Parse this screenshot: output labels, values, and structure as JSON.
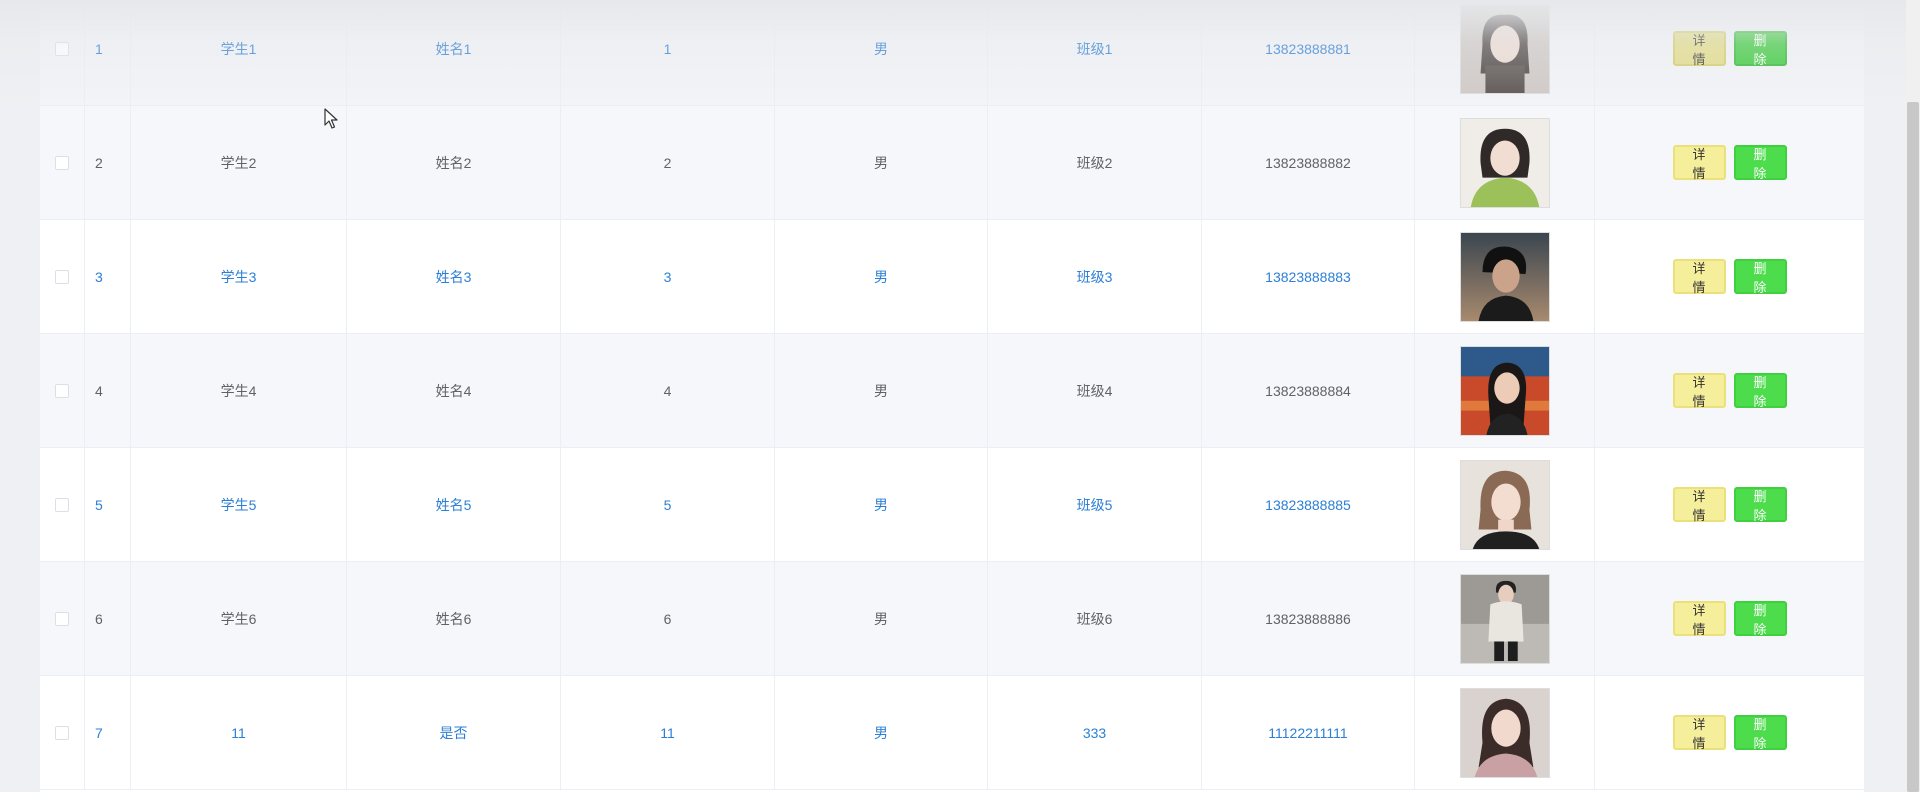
{
  "table": {
    "rows": [
      {
        "index": "1",
        "student": "学生1",
        "name": "姓名1",
        "number": "1",
        "gender": "男",
        "class": "班级1",
        "phone": "13823888881",
        "detail_label": "详情",
        "delete_label": "删除",
        "avatar": "avatar-photo-1"
      },
      {
        "index": "2",
        "student": "学生2",
        "name": "姓名2",
        "number": "2",
        "gender": "男",
        "class": "班级2",
        "phone": "13823888882",
        "detail_label": "详情",
        "delete_label": "删除",
        "avatar": "avatar-photo-2"
      },
      {
        "index": "3",
        "student": "学生3",
        "name": "姓名3",
        "number": "3",
        "gender": "男",
        "class": "班级3",
        "phone": "13823888883",
        "detail_label": "详情",
        "delete_label": "删除",
        "avatar": "avatar-photo-3"
      },
      {
        "index": "4",
        "student": "学生4",
        "name": "姓名4",
        "number": "4",
        "gender": "男",
        "class": "班级4",
        "phone": "13823888884",
        "detail_label": "详情",
        "delete_label": "删除",
        "avatar": "avatar-photo-4"
      },
      {
        "index": "5",
        "student": "学生5",
        "name": "姓名5",
        "number": "5",
        "gender": "男",
        "class": "班级5",
        "phone": "13823888885",
        "detail_label": "详情",
        "delete_label": "删除",
        "avatar": "avatar-photo-5"
      },
      {
        "index": "6",
        "student": "学生6",
        "name": "姓名6",
        "number": "6",
        "gender": "男",
        "class": "班级6",
        "phone": "13823888886",
        "detail_label": "详情",
        "delete_label": "删除",
        "avatar": "avatar-photo-6"
      },
      {
        "index": "7",
        "student": "11",
        "name": "是否",
        "number": "11",
        "gender": "男",
        "class": "333",
        "phone": "11122211111",
        "detail_label": "详情",
        "delete_label": "删除",
        "avatar": "avatar-photo-7"
      }
    ]
  },
  "colors": {
    "link_text": "#2b7fd6",
    "plain_text": "#606266",
    "detail_button": "#f5ef9c",
    "delete_button": "#4cdc4c",
    "striped_row": "#f5f7fa"
  }
}
